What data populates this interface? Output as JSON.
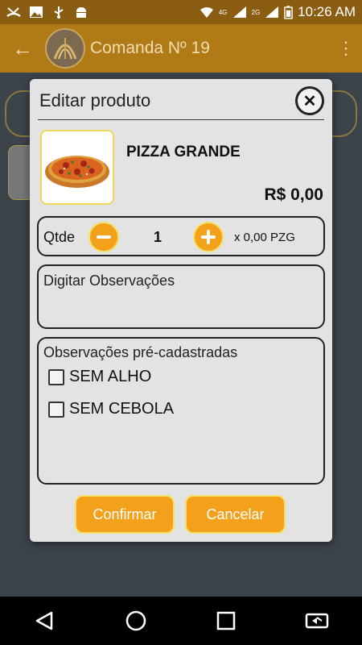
{
  "status_bar": {
    "left_icons": [
      "missed-call-icon",
      "image-icon",
      "usb-icon",
      "android-icon"
    ],
    "network_labels": [
      "4G",
      "2G"
    ],
    "time": "10:26 AM"
  },
  "app_bar": {
    "title": "Comanda Nº 19",
    "back_icon": "arrow-left-icon",
    "menu_icon": "more-vert-icon"
  },
  "dialog": {
    "title": "Editar produto",
    "close_icon": "close-icon",
    "product": {
      "name": "PIZZA GRANDE",
      "price": "R$ 0,00",
      "image_icon": "pizza-image"
    },
    "quantity": {
      "label": "Qtde",
      "value": "1",
      "unit": "x 0,00 PZG"
    },
    "observations": {
      "placeholder": "Digitar Observações"
    },
    "preset_observations": {
      "label": "Observações pré-cadastradas",
      "items": [
        {
          "label": "SEM ALHO",
          "checked": false
        },
        {
          "label": "SEM CEBOLA",
          "checked": false
        }
      ]
    },
    "buttons": {
      "confirm": "Confirmar",
      "cancel": "Cancelar"
    }
  },
  "colors": {
    "app_bar": "#b07a16",
    "status_bar": "#8a5d12",
    "accent": "#f3a01a",
    "dialog_bg": "#e3e3e3"
  }
}
